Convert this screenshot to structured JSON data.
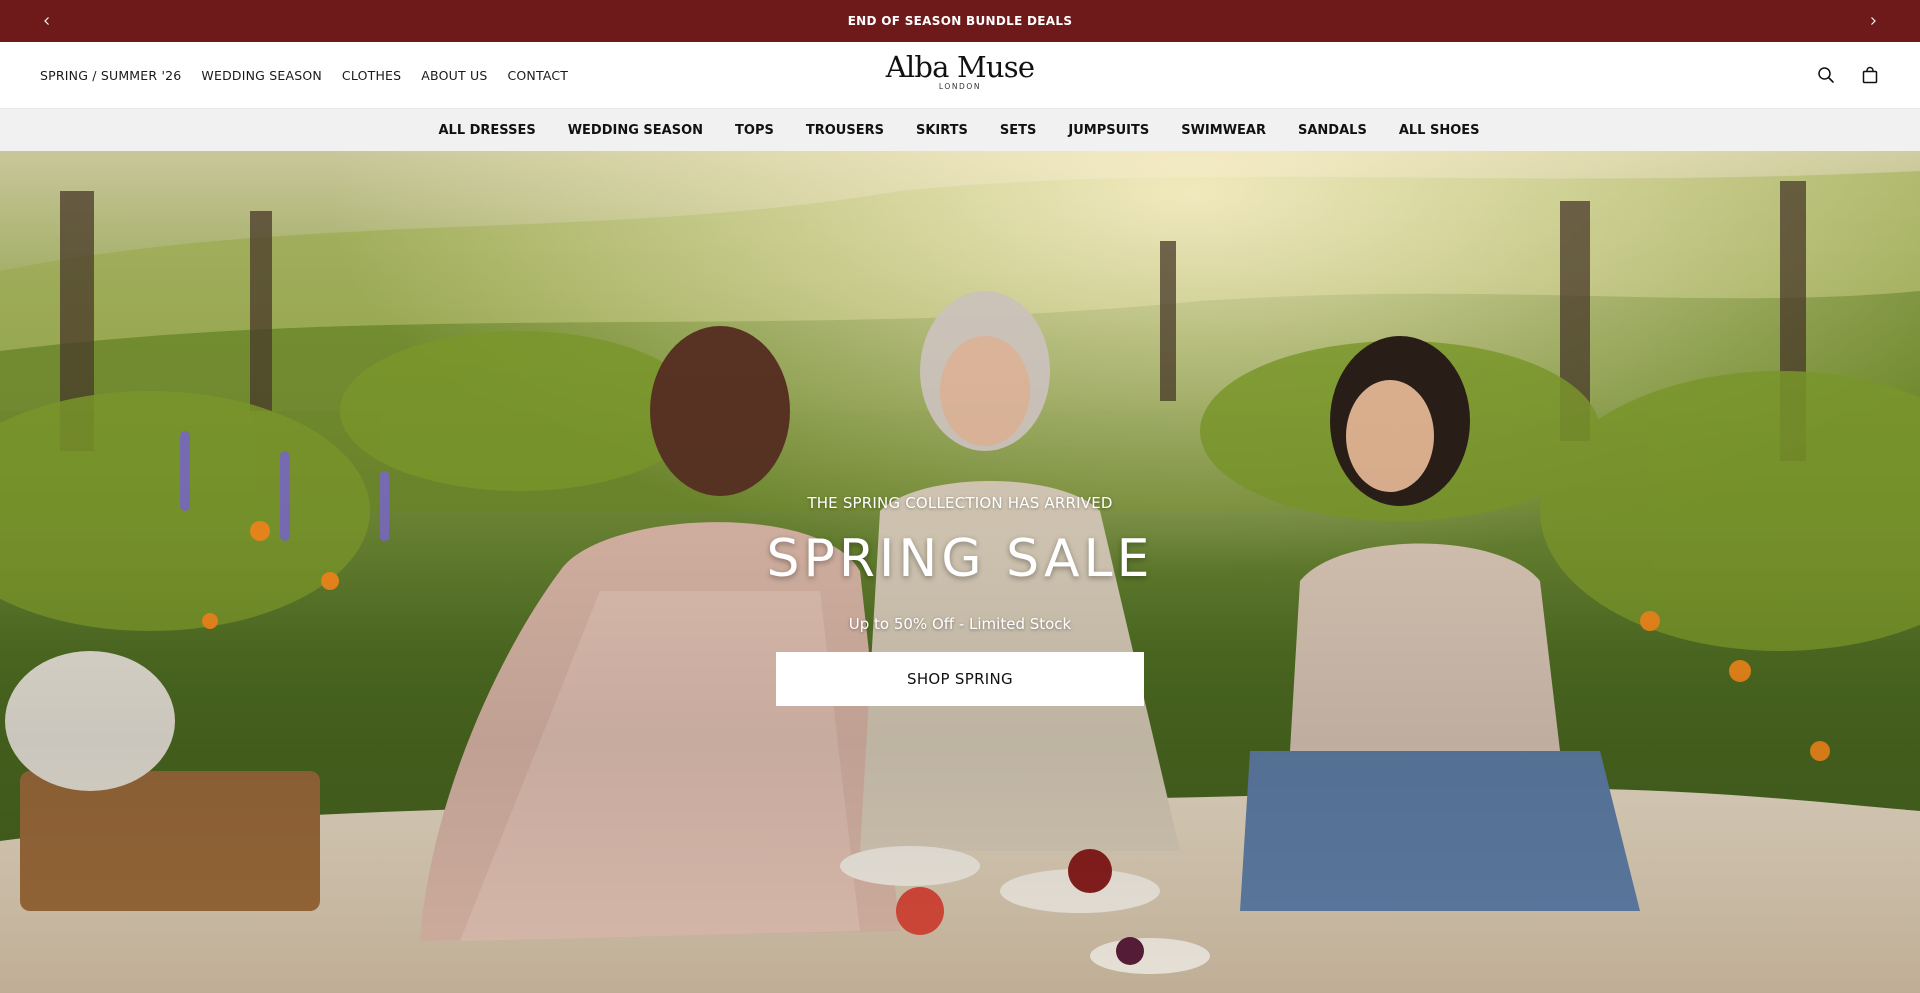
{
  "announcement": {
    "text": "END OF SEASON BUNDLE DEALS",
    "prev_icon": "chevron-left-icon",
    "next_icon": "chevron-right-icon"
  },
  "header": {
    "nav": [
      {
        "label": "SPRING / SUMMER '26"
      },
      {
        "label": "WEDDING SEASON"
      },
      {
        "label": "CLOTHES"
      },
      {
        "label": "ABOUT US"
      },
      {
        "label": "CONTACT"
      }
    ],
    "logo": {
      "name": "Alba Muse",
      "sub": "LONDON"
    },
    "icons": [
      "search-icon",
      "shopping-bag-icon"
    ]
  },
  "categories": [
    {
      "label": "ALL DRESSES"
    },
    {
      "label": "WEDDING SEASON"
    },
    {
      "label": "TOPS"
    },
    {
      "label": "TROUSERS"
    },
    {
      "label": "SKIRTS"
    },
    {
      "label": "SETS"
    },
    {
      "label": "JUMPSUITS"
    },
    {
      "label": "SWIMWEAR"
    },
    {
      "label": "SANDALS"
    },
    {
      "label": "ALL SHOES"
    }
  ],
  "hero": {
    "eyebrow": "THE SPRING COLLECTION HAS ARRIVED",
    "title": "SPRING SALE",
    "subtitle": "Up to 50% Off - Limited Stock",
    "cta": "SHOP SPRING"
  },
  "colors": {
    "announcement_bg": "#6e1a1a",
    "category_bar_bg": "#f1f1f1",
    "text": "#1a1a1a"
  }
}
